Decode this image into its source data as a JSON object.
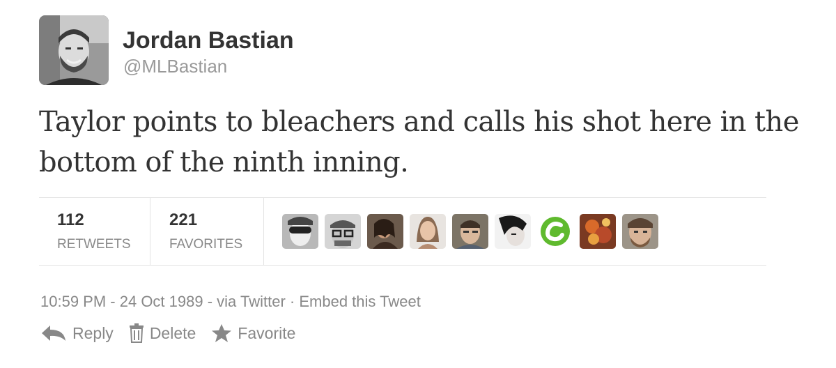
{
  "author": {
    "name": "Jordan Bastian",
    "handle": "@MLBastian",
    "avatar_icon": "profile-photo"
  },
  "tweet": {
    "text": "Taylor points to bleachers and calls his shot here in the bottom of the ninth inning."
  },
  "stats": {
    "retweets": {
      "count": "112",
      "label": "RETWEETS"
    },
    "favorites": {
      "count": "221",
      "label": "FAVORITES"
    }
  },
  "favoriters": [
    {
      "icon": "user-avatar-1"
    },
    {
      "icon": "user-avatar-2"
    },
    {
      "icon": "user-avatar-3"
    },
    {
      "icon": "user-avatar-4"
    },
    {
      "icon": "user-avatar-5"
    },
    {
      "icon": "user-avatar-6"
    },
    {
      "icon": "user-avatar-7"
    },
    {
      "icon": "user-avatar-8"
    },
    {
      "icon": "user-avatar-9"
    }
  ],
  "meta": {
    "time": "10:59 PM",
    "sep1": " - ",
    "date": "24 Oct 1989",
    "sep2": " - ",
    "via": "via Twitter",
    "sep3": " · ",
    "embed": "Embed this Tweet"
  },
  "actions": {
    "reply": "Reply",
    "delete": "Delete",
    "favorite": "Favorite"
  },
  "colors": {
    "text": "#333333",
    "muted": "#888888",
    "handle": "#999999",
    "divider": "#e3e3e3"
  }
}
